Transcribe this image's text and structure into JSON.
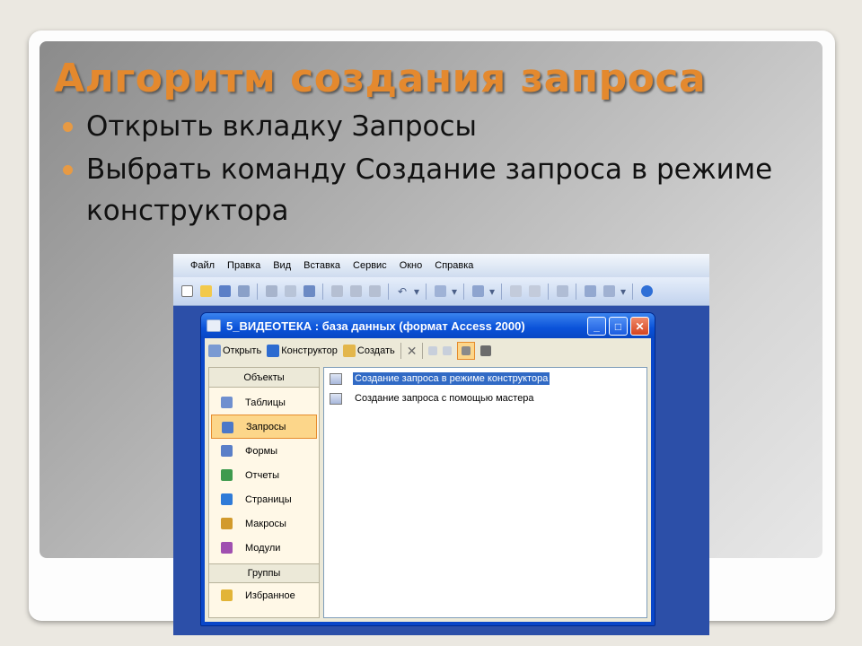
{
  "slide": {
    "title": "Алгоритм создания запроса",
    "bullets": [
      "Открыть вкладку Запросы",
      "Выбрать команду Создание запроса в режиме конструктора"
    ],
    "bullet_line2": [
      "Выбрать команду Создание запроса в",
      "режиме конструктора"
    ]
  },
  "app": {
    "menu": [
      "Файл",
      "Правка",
      "Вид",
      "Вставка",
      "Сервис",
      "Окно",
      "Справка"
    ],
    "toolbar_icons": [
      "new-icon",
      "open-icon",
      "save-icon",
      "search-icon",
      "print-icon",
      "preview-icon",
      "spelling-icon",
      "cut-icon",
      "copy-icon",
      "paste-icon",
      "undo-icon",
      "office-links-icon",
      "analyze-icon",
      "code-icon",
      "script-icon",
      "properties-icon",
      "relationships-icon",
      "new-object-icon",
      "help-icon"
    ]
  },
  "db_window": {
    "title": "5_ВИДЕОТЕКА : база данных (формат Access 2000)",
    "buttons": {
      "minimize": "_",
      "maximize": "□",
      "close": "✕"
    },
    "toolbar": {
      "open": "Открыть",
      "design": "Конструктор",
      "create": "Создать"
    },
    "objects_header": "Объекты",
    "objects": [
      {
        "label": "Таблицы",
        "icon": "table-icon",
        "color": "#6f8fcf"
      },
      {
        "label": "Запросы",
        "icon": "query-icon",
        "color": "#4c78c8",
        "selected": true
      },
      {
        "label": "Формы",
        "icon": "form-icon",
        "color": "#5a7fc8"
      },
      {
        "label": "Отчеты",
        "icon": "report-icon",
        "color": "#3e9a4e"
      },
      {
        "label": "Страницы",
        "icon": "page-icon",
        "color": "#2f7bd8"
      },
      {
        "label": "Макросы",
        "icon": "macro-icon",
        "color": "#d29a2c"
      },
      {
        "label": "Модули",
        "icon": "module-icon",
        "color": "#a04fb0"
      }
    ],
    "groups_header": "Группы",
    "groups": [
      {
        "label": "Избранное",
        "icon": "favorites-icon",
        "color": "#e2b437"
      }
    ],
    "list_items": [
      {
        "label": "Создание запроса в режиме конструктора",
        "icon": "query-design-icon",
        "selected": true
      },
      {
        "label": "Создание запроса с помощью мастера",
        "icon": "query-wizard-icon",
        "selected": false
      }
    ]
  },
  "colors": {
    "title_orange": "#e4892e",
    "bullet_orange": "#e79a44",
    "xp_blue": "#0a52d9",
    "selection": "#316ac5",
    "selected_item_bg": "#fcd68a"
  }
}
